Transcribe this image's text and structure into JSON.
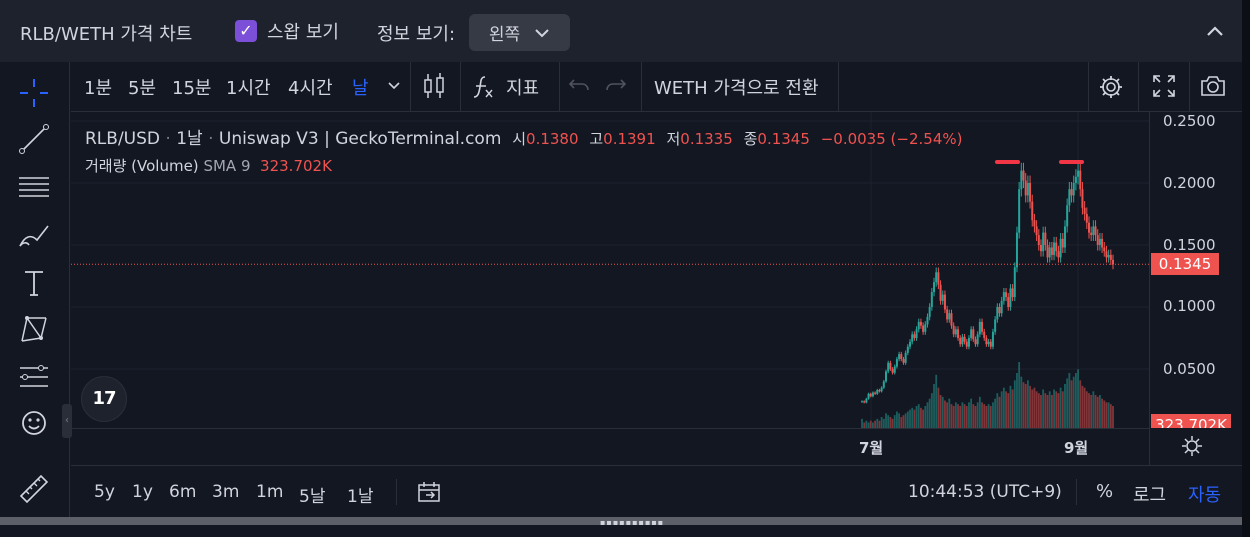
{
  "header": {
    "title": "RLB/WETH 가격 차트",
    "swap_label": "스왑 보기",
    "info_label": "정보 보기:",
    "info_value": "왼쪽"
  },
  "toolbar": {
    "timeframes": [
      "1분",
      "5분",
      "15분",
      "1시간",
      "4시간",
      "날"
    ],
    "active_timeframe": "날",
    "indicators_label": "지표",
    "convert_label": "WETH 가격으로 전환"
  },
  "legend": {
    "symbol": "RLB/USD",
    "interval": "1날",
    "source": "Uniswap V3",
    "provider": "GeckoTerminal.com",
    "open_label": "시",
    "open": "0.1380",
    "high_label": "고",
    "high": "0.1391",
    "low_label": "저",
    "low": "0.1335",
    "close_label": "종",
    "close": "0.1345",
    "change": "−0.0035 (−2.54%)",
    "volume_label": "거래량 (Volume)",
    "sma_label": "SMA 9",
    "volume_value": "323.702K"
  },
  "logo_text": "17",
  "price_axis": {
    "ticks": [
      "0.2500",
      "0.2000",
      "0.1500",
      "0.1000",
      "0.0500"
    ],
    "last_price": "0.1345",
    "last_volume": "323.702K"
  },
  "time_axis": {
    "ticks": [
      "7월",
      "9월"
    ]
  },
  "bottom": {
    "ranges": [
      "5y",
      "1y",
      "6m",
      "3m",
      "1m",
      "5날",
      "1날"
    ],
    "clock": "10:44:53 (UTC+9)",
    "percent_label": "%",
    "log_label": "로그",
    "auto_label": "자동"
  },
  "colors": {
    "up": "#26a69a",
    "down": "#ef5350",
    "accent": "#2962ff",
    "background": "#131722"
  },
  "chart_data": {
    "type": "candlestick",
    "series": "RLB/USD",
    "ylim": [
      0,
      0.25
    ],
    "last_close": 0.1345,
    "x_labels": [
      "7월",
      "9월"
    ],
    "closes": [
      0.024,
      0.023,
      0.026,
      0.03,
      0.028,
      0.031,
      0.03,
      0.033,
      0.032,
      0.035,
      0.04,
      0.048,
      0.055,
      0.05,
      0.047,
      0.052,
      0.058,
      0.062,
      0.058,
      0.055,
      0.063,
      0.068,
      0.072,
      0.078,
      0.075,
      0.082,
      0.088,
      0.085,
      0.08,
      0.086,
      0.092,
      0.1,
      0.112,
      0.12,
      0.128,
      0.118,
      0.105,
      0.11,
      0.098,
      0.09,
      0.095,
      0.085,
      0.078,
      0.082,
      0.075,
      0.07,
      0.076,
      0.072,
      0.068,
      0.075,
      0.082,
      0.074,
      0.07,
      0.078,
      0.088,
      0.08,
      0.075,
      0.07,
      0.072,
      0.068,
      0.08,
      0.09,
      0.1,
      0.095,
      0.105,
      0.112,
      0.108,
      0.1,
      0.115,
      0.108,
      0.132,
      0.16,
      0.195,
      0.21,
      0.202,
      0.19,
      0.2,
      0.185,
      0.17,
      0.165,
      0.158,
      0.15,
      0.145,
      0.16,
      0.15,
      0.14,
      0.148,
      0.142,
      0.152,
      0.145,
      0.14,
      0.155,
      0.148,
      0.165,
      0.182,
      0.195,
      0.19,
      0.2,
      0.205,
      0.21,
      0.195,
      0.18,
      0.175,
      0.168,
      0.16,
      0.158,
      0.165,
      0.158,
      0.15,
      0.155,
      0.148,
      0.145,
      0.14,
      0.142,
      0.138,
      0.1345
    ],
    "volumes": [
      0.5,
      0.3,
      0.4,
      0.3,
      0.4,
      0.3,
      0.4,
      0.5,
      0.4,
      0.6,
      0.5,
      0.8,
      0.7,
      0.6,
      0.5,
      0.7,
      0.9,
      0.8,
      0.6,
      0.7,
      0.8,
      0.9,
      1.0,
      1.1,
      1.0,
      1.2,
      1.3,
      1.1,
      1.0,
      1.2,
      1.4,
      1.6,
      1.9,
      2.4,
      2.9,
      2.2,
      1.8,
      1.7,
      1.5,
      1.4,
      1.6,
      1.3,
      1.2,
      1.4,
      1.3,
      1.2,
      1.4,
      1.3,
      1.2,
      1.4,
      1.6,
      1.3,
      1.2,
      1.4,
      1.7,
      1.4,
      1.3,
      1.2,
      1.3,
      1.2,
      1.4,
      1.6,
      1.9,
      1.7,
      2.0,
      2.2,
      2.0,
      1.9,
      2.3,
      2.1,
      2.6,
      3.0,
      3.6,
      2.8,
      2.5,
      2.4,
      2.6,
      2.3,
      2.1,
      2.2,
      2.0,
      1.9,
      1.8,
      2.1,
      1.9,
      1.8,
      2.0,
      1.8,
      2.1,
      2.0,
      1.9,
      2.2,
      2.0,
      2.4,
      2.7,
      3.0,
      2.6,
      2.8,
      3.0,
      3.2,
      2.6,
      2.3,
      2.2,
      2.0,
      1.9,
      1.8,
      2.0,
      1.8,
      1.7,
      1.8,
      1.6,
      1.5,
      1.4,
      1.4,
      1.3,
      1.2
    ]
  }
}
